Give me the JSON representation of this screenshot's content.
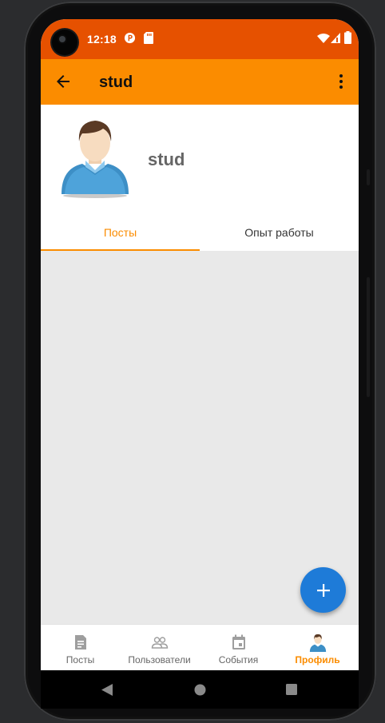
{
  "status_bar": {
    "time": "12:18",
    "icons": [
      "camera-hole",
      "sync-badge-icon",
      "sd-card-icon",
      "wifi-icon",
      "signal-icon",
      "battery-icon"
    ]
  },
  "toolbar": {
    "title": "stud",
    "back_icon": "arrow-back-icon",
    "more_icon": "more-vert-icon"
  },
  "profile": {
    "username": "stud",
    "avatar_icon": "user-avatar-icon"
  },
  "tabs": [
    {
      "label": "Посты",
      "active": true
    },
    {
      "label": "Опыт работы",
      "active": false
    }
  ],
  "fab": {
    "icon": "plus-icon",
    "label": "+"
  },
  "bottom_nav": [
    {
      "label": "Посты",
      "icon": "document-icon",
      "active": false
    },
    {
      "label": "Пользователи",
      "icon": "people-icon",
      "active": false
    },
    {
      "label": "События",
      "icon": "calendar-icon",
      "active": false
    },
    {
      "label": "Профиль",
      "icon": "user-avatar-icon",
      "active": true
    }
  ],
  "colors": {
    "status_bar": "#e65100",
    "toolbar": "#fb8c00",
    "accent": "#fb8c00",
    "fab": "#1e7bd8",
    "content_bg": "#e9e9e9"
  },
  "system_nav": [
    "back-triangle-icon",
    "home-circle-icon",
    "recents-square-icon"
  ]
}
